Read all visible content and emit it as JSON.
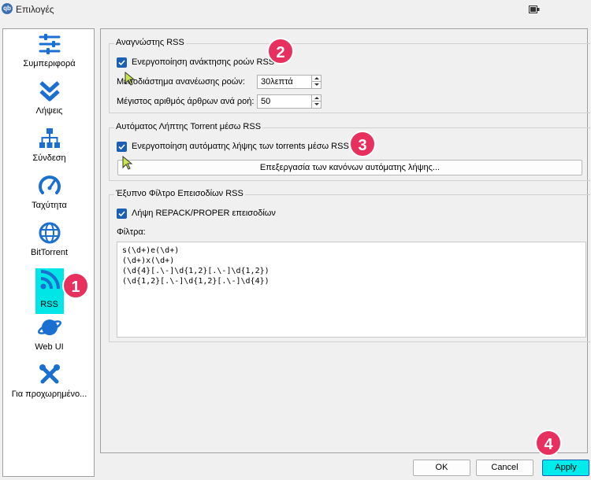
{
  "window": {
    "title": "Επιλογές",
    "app_icon_text": "qb"
  },
  "sidebar": {
    "items": [
      {
        "label": "Συμπεριφορά",
        "icon": "sliders-icon"
      },
      {
        "label": "Λήψεις",
        "icon": "double-chevron-down-icon"
      },
      {
        "label": "Σύνδεση",
        "icon": "network-icon"
      },
      {
        "label": "Ταχύτητα",
        "icon": "speedometer-icon"
      },
      {
        "label": "BitTorrent",
        "icon": "globe-icon"
      },
      {
        "label": "RSS",
        "icon": "rss-icon",
        "selected": true
      },
      {
        "label": "Web UI",
        "icon": "planet-icon"
      },
      {
        "label": "Για προχωρημένο...",
        "icon": "tools-icon"
      }
    ]
  },
  "rss_reader": {
    "title": "Αναγνώστης RSS",
    "enable_label": "Ενεργοποίηση ανάκτησης ροών RSS",
    "enabled": true,
    "interval_label": "Μεσοδιάστημα ανανέωσης ροών:",
    "interval_value": "30λεπτά",
    "max_articles_label": "Μέγιστος αριθμός άρθρων ανά ροή:",
    "max_articles_value": "50"
  },
  "auto_downloader": {
    "title": "Αυτόματος Λήπτης Torrent μέσω RSS",
    "enable_label": "Ενεργοποίηση αυτόματης λήψης των torrents μέσω RSS",
    "enabled": true,
    "edit_rules_label": "Επεξεργασία των κανόνων αυτόματης λήψης..."
  },
  "smart_filter": {
    "title": "Έξυπνο Φίλτρο Επεισοδίων RSS",
    "repack_label": "Λήψη REPACK/PROPER επεισοδίων",
    "repack_enabled": true,
    "filters_label": "Φίλτρα:",
    "filters": [
      "s(\\d+)e(\\d+)",
      "(\\d+)x(\\d+)",
      "(\\d{4}[.\\-]\\d{1,2}[.\\-]\\d{1,2})",
      "(\\d{1,2}[.\\-]\\d{1,2}[.\\-]\\d{4})"
    ]
  },
  "footer": {
    "ok_label": "OK",
    "cancel_label": "Cancel",
    "apply_label": "Apply"
  },
  "callouts": [
    "1",
    "2",
    "3",
    "4"
  ],
  "colors": {
    "accent": "#1a5fb4",
    "highlight": "#00e5e5",
    "badge": "#e8305f",
    "icon": "#1a6fd1"
  }
}
